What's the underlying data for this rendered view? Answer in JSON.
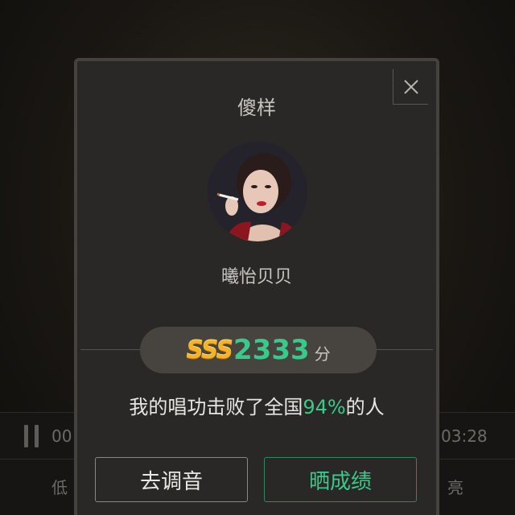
{
  "background": {
    "time_left": "00",
    "time_right": "03:28",
    "label_left": "低",
    "label_right": "亮"
  },
  "modal": {
    "title": "傻样",
    "username": "曦怡贝贝",
    "rank_badge": "SSS",
    "score": "2333",
    "score_unit": "分",
    "beat_prefix": "我的唱功击败了全国",
    "beat_percent": "94%",
    "beat_suffix": "的人",
    "tune_button": "去调音",
    "share_button": "晒成绩"
  },
  "icons": {
    "close": "close-icon",
    "pause": "pause-icon"
  },
  "colors": {
    "accent_green": "#39c98a",
    "badge_gold": "#f4b32a"
  }
}
